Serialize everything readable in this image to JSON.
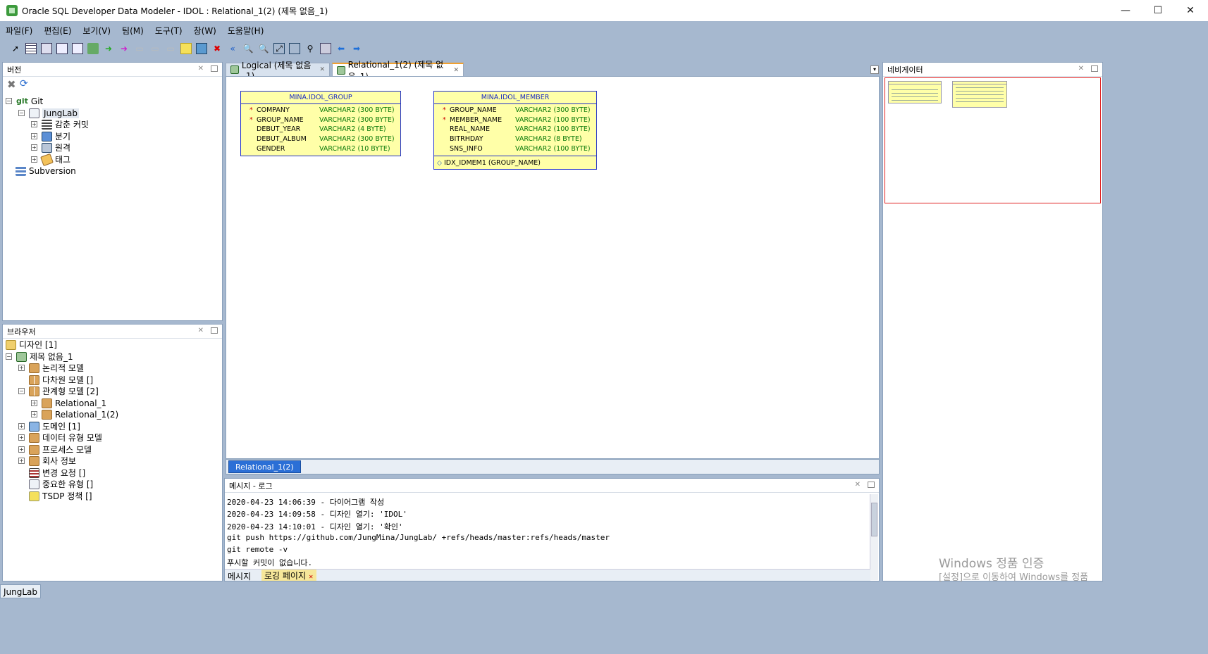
{
  "window": {
    "title": "Oracle SQL Developer Data Modeler - IDOL : Relational_1(2) (제목 없음_1)",
    "minimize": "—",
    "maximize": "☐",
    "close": "✕"
  },
  "menu": [
    "파일(F)",
    "편집(E)",
    "보기(V)",
    "팀(M)",
    "도구(T)",
    "창(W)",
    "도움말(H)"
  ],
  "versions_panel": {
    "title": "버전",
    "tree": [
      {
        "label": "Git",
        "icon": "git-icon"
      },
      {
        "label": "JungLab",
        "icon": "repository-icon"
      },
      {
        "label": "감춘 커밋",
        "icon": "list-icon"
      },
      {
        "label": "분기",
        "icon": "branch-icon"
      },
      {
        "label": "원격",
        "icon": "remote-icon"
      },
      {
        "label": "태그",
        "icon": "tag-icon"
      },
      {
        "label": "Subversion",
        "icon": "subversion-icon"
      }
    ]
  },
  "browser_panel": {
    "title": "브라우저",
    "tree": [
      {
        "label": "디자인 [1]"
      },
      {
        "label": "제목 없음_1"
      },
      {
        "label": "논리적 모델"
      },
      {
        "label": "다차원 모델 []"
      },
      {
        "label": "관계형 모델 [2]"
      },
      {
        "label": "Relational_1"
      },
      {
        "label": "Relational_1(2)"
      },
      {
        "label": "도메인 [1]"
      },
      {
        "label": "데이터 유형 모델"
      },
      {
        "label": "프로세스 모델"
      },
      {
        "label": "회사 정보"
      },
      {
        "label": "변경 요청 []"
      },
      {
        "label": "중요한 유형 []"
      },
      {
        "label": "TSDP 정책 []"
      }
    ]
  },
  "editor_tabs": [
    {
      "label": "Logical (제목 없음_1)",
      "active": false
    },
    {
      "label": "Relational_1(2) (제목 없음_1)",
      "active": true
    }
  ],
  "diagram": {
    "entities": [
      {
        "name": "MINA.IDOL_GROUP",
        "columns": [
          {
            "required": true,
            "name": "COMPANY",
            "type": "VARCHAR2 (300 BYTE)"
          },
          {
            "required": true,
            "name": "GROUP_NAME",
            "type": "VARCHAR2 (300 BYTE)"
          },
          {
            "required": false,
            "name": "DEBUT_YEAR",
            "type": "VARCHAR2 (4 BYTE)"
          },
          {
            "required": false,
            "name": "DEBUT_ALBUM",
            "type": "VARCHAR2 (300 BYTE)"
          },
          {
            "required": false,
            "name": "GENDER",
            "type": "VARCHAR2 (10 BYTE)"
          }
        ],
        "indexes": []
      },
      {
        "name": "MINA.IDOL_MEMBER",
        "columns": [
          {
            "required": true,
            "name": "GROUP_NAME",
            "type": "VARCHAR2 (300 BYTE)"
          },
          {
            "required": true,
            "name": "MEMBER_NAME",
            "type": "VARCHAR2 (100 BYTE)"
          },
          {
            "required": false,
            "name": "REAL_NAME",
            "type": "VARCHAR2 (100 BYTE)"
          },
          {
            "required": false,
            "name": "BITRHDAY",
            "type": "VARCHAR2 (8 BYTE)"
          },
          {
            "required": false,
            "name": "SNS_INFO",
            "type": "VARCHAR2 (100 BYTE)"
          }
        ],
        "indexes": [
          "IDX_IDMEM1 (GROUP_NAME)"
        ]
      }
    ],
    "subtab": "Relational_1(2)",
    "required_marker": "*"
  },
  "navigator_panel": {
    "title": "네비게이터"
  },
  "log_panel": {
    "title": "메시지 - 로그",
    "lines": [
      "2020-04-23 14:06:39 - 다이어그램 작성",
      "2020-04-23 14:09:58 - 디자인 열기: 'IDOL'",
      "2020-04-23 14:10:01 - 디자인 열기: '확인'",
      "git push https://github.com/JungMina/JungLab/ +refs/heads/master:refs/heads/master",
      "git remote -v",
      "푸시할 커밋이 없습니다."
    ],
    "tabs": [
      "메시지",
      "로깅 페이지"
    ]
  },
  "statusbar": {
    "label": "JungLab"
  },
  "watermark": {
    "line1": "Windows 정품 인증",
    "line2": "[설정]으로 이동하여 Windows를 정품"
  }
}
